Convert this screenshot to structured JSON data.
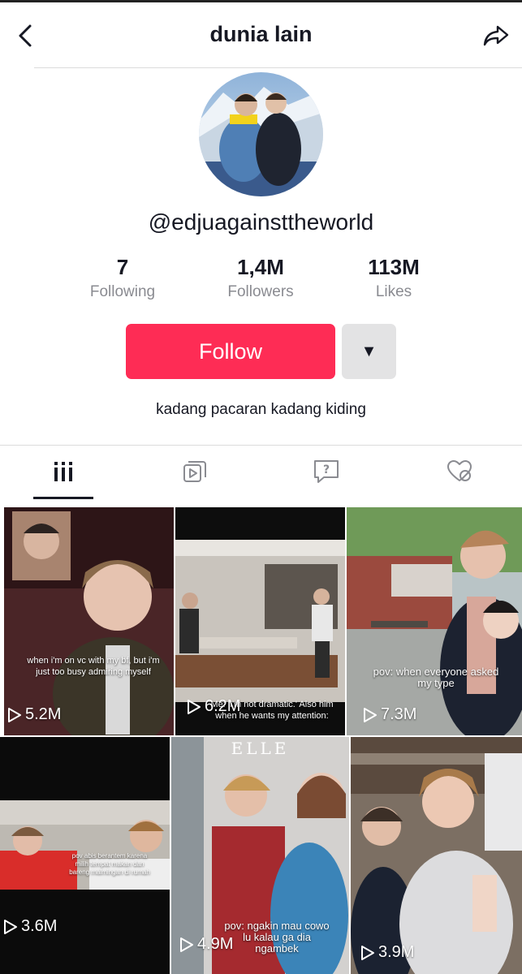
{
  "header": {
    "title": "dunia lain",
    "back_icon": "chevron-left-icon",
    "share_icon": "share-arrow-icon"
  },
  "profile": {
    "username": "@edjuagainsttheworld",
    "bio": "kadang pacaran kadang kiding"
  },
  "stats": {
    "following": {
      "value": "7",
      "label": "Following"
    },
    "followers": {
      "value": "1,4M",
      "label": "Followers"
    },
    "likes": {
      "value": "113M",
      "label": "Likes"
    }
  },
  "actions": {
    "follow_label": "Follow",
    "dropdown_symbol": "▼",
    "accent_color": "#fe2c55"
  },
  "tabs": [
    {
      "icon": "grid-videos-icon",
      "active": true
    },
    {
      "icon": "reposts-icon",
      "active": false
    },
    {
      "icon": "question-icon",
      "active": false
    },
    {
      "icon": "liked-hidden-icon",
      "active": false
    }
  ],
  "videos": [
    {
      "views": "5.2M",
      "caption": "when i'm on vc with my bf, but i'm just too busy admiring myself"
    },
    {
      "views": "6.2M",
      "caption": "Me: 'I'm not dramatic.' Also him when he wants my attention:"
    },
    {
      "views": "7.3M",
      "caption": "pov: when everyone asked my type"
    },
    {
      "views": "3.6M",
      "caption": "pov abis berantem karena milih tempat makan dan bareng malmingan di rumah"
    },
    {
      "views": "4.9M",
      "caption": "pov: ngakin mau cowo lu kalau ga dia ngambek",
      "overlay": "ELLE"
    },
    {
      "views": "3.9M",
      "caption": ""
    }
  ]
}
